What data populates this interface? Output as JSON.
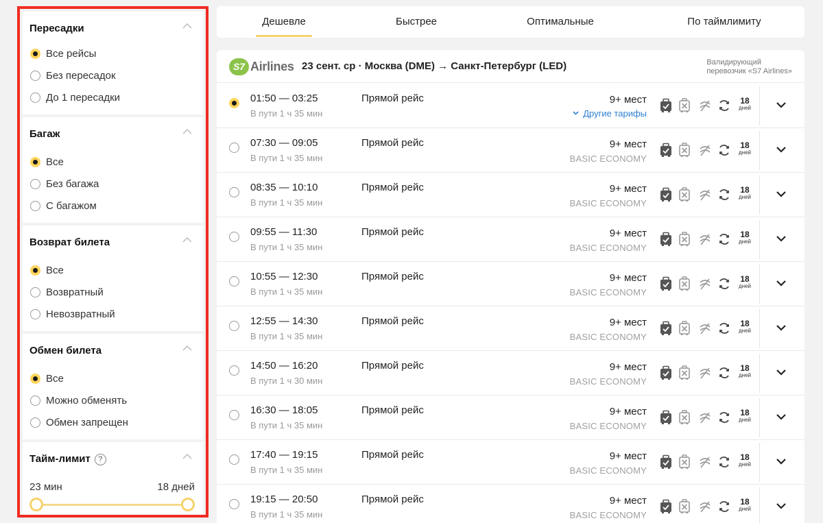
{
  "filters": {
    "transfers": {
      "title": "Пересадки",
      "options": [
        {
          "label": "Все рейсы",
          "selected": true
        },
        {
          "label": "Без пересадок",
          "selected": false
        },
        {
          "label": "До 1 пересадки",
          "selected": false
        }
      ]
    },
    "baggage": {
      "title": "Багаж",
      "options": [
        {
          "label": "Все",
          "selected": true
        },
        {
          "label": "Без багажа",
          "selected": false
        },
        {
          "label": "С багажом",
          "selected": false
        }
      ]
    },
    "refund": {
      "title": "Возврат билета",
      "options": [
        {
          "label": "Все",
          "selected": true
        },
        {
          "label": "Возвратный",
          "selected": false
        },
        {
          "label": "Невозвратный",
          "selected": false
        }
      ]
    },
    "exchange": {
      "title": "Обмен билета",
      "options": [
        {
          "label": "Все",
          "selected": true
        },
        {
          "label": "Можно обменять",
          "selected": false
        },
        {
          "label": "Обмен запрещен",
          "selected": false
        }
      ]
    },
    "time_limit": {
      "title": "Тайм-лимит",
      "help": "?",
      "min_label": "23 мин",
      "max_label": "18 дней",
      "range_low": 0,
      "range_high": 1
    }
  },
  "tabs": [
    {
      "label": "Дешевле",
      "active": true
    },
    {
      "label": "Быстрее",
      "active": false
    },
    {
      "label": "Оптимальные",
      "active": false
    },
    {
      "label": "По таймлимиту",
      "active": false
    }
  ],
  "results": {
    "airline_logo": {
      "mark": "S7",
      "text": "Airlines"
    },
    "route": "23 сент. ср · Москва (DME) → Санкт-Петербург (LED)",
    "validator_line1": "Валидирующий",
    "validator_line2": "перевозчик «S7 Airlines»",
    "flights": [
      {
        "times": "01:50 — 03:25",
        "duration": "В пути 1 ч 35 мин",
        "type": "Прямой рейс",
        "seats": "9+ мест",
        "fare": "Другие тарифы",
        "fare_is_link": true,
        "selected": true,
        "days_num": "18",
        "days_unit": "дней"
      },
      {
        "times": "07:30 — 09:05",
        "duration": "В пути 1 ч 35 мин",
        "type": "Прямой рейс",
        "seats": "9+ мест",
        "fare": "BASIC ECONOMY",
        "fare_is_link": false,
        "selected": false,
        "days_num": "18",
        "days_unit": "дней"
      },
      {
        "times": "08:35 — 10:10",
        "duration": "В пути 1 ч 35 мин",
        "type": "Прямой рейс",
        "seats": "9+ мест",
        "fare": "BASIC ECONOMY",
        "fare_is_link": false,
        "selected": false,
        "days_num": "18",
        "days_unit": "дней"
      },
      {
        "times": "09:55 — 11:30",
        "duration": "В пути 1 ч 35 мин",
        "type": "Прямой рейс",
        "seats": "9+ мест",
        "fare": "BASIC ECONOMY",
        "fare_is_link": false,
        "selected": false,
        "days_num": "18",
        "days_unit": "дней"
      },
      {
        "times": "10:55 — 12:30",
        "duration": "В пути 1 ч 35 мин",
        "type": "Прямой рейс",
        "seats": "9+ мест",
        "fare": "BASIC ECONOMY",
        "fare_is_link": false,
        "selected": false,
        "days_num": "18",
        "days_unit": "дней"
      },
      {
        "times": "12:55 — 14:30",
        "duration": "В пути 1 ч 35 мин",
        "type": "Прямой рейс",
        "seats": "9+ мест",
        "fare": "BASIC ECONOMY",
        "fare_is_link": false,
        "selected": false,
        "days_num": "18",
        "days_unit": "дней"
      },
      {
        "times": "14:50 — 16:20",
        "duration": "В пути 1 ч 30 мин",
        "type": "Прямой рейс",
        "seats": "9+ мест",
        "fare": "BASIC ECONOMY",
        "fare_is_link": false,
        "selected": false,
        "days_num": "18",
        "days_unit": "дней"
      },
      {
        "times": "16:30 — 18:05",
        "duration": "В пути 1 ч 35 мин",
        "type": "Прямой рейс",
        "seats": "9+ мест",
        "fare": "BASIC ECONOMY",
        "fare_is_link": false,
        "selected": false,
        "days_num": "18",
        "days_unit": "дней"
      },
      {
        "times": "17:40 — 19:15",
        "duration": "В пути 1 ч 35 мин",
        "type": "Прямой рейс",
        "seats": "9+ мест",
        "fare": "BASIC ECONOMY",
        "fare_is_link": false,
        "selected": false,
        "days_num": "18",
        "days_unit": "дней"
      },
      {
        "times": "19:15 — 20:50",
        "duration": "В пути 1 ч 35 мин",
        "type": "Прямой рейс",
        "seats": "9+ мест",
        "fare": "BASIC ECONOMY",
        "fare_is_link": false,
        "selected": false,
        "days_num": "18",
        "days_unit": "дней"
      }
    ]
  },
  "icons": {
    "carry_on": "hand-luggage-icon",
    "no_baggage": "no-baggage-icon",
    "no_refund": "no-refund-icon",
    "exchange": "exchange-icon"
  },
  "colors": {
    "accent_yellow": "#f6d26a",
    "highlight_border": "#f02c22",
    "link_blue": "#2f80d0",
    "s7_green": "#8bc34a"
  }
}
